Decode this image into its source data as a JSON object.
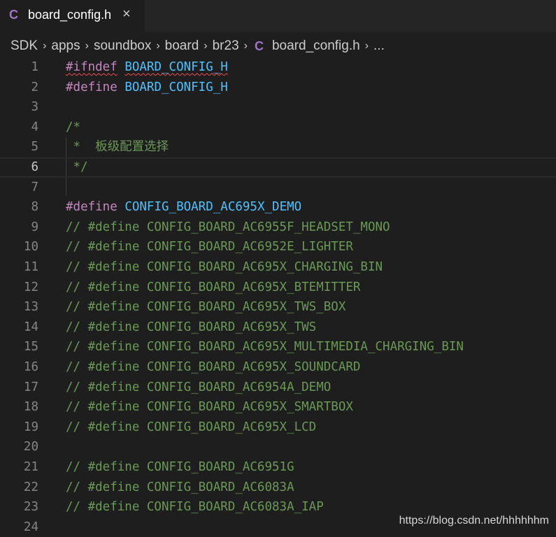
{
  "tab": {
    "icon": "C",
    "label": "board_config.h",
    "close": "×"
  },
  "breadcrumb": {
    "items": [
      "SDK",
      "apps",
      "soundbox",
      "board",
      "br23"
    ],
    "file_icon": "C",
    "file": "board_config.h",
    "more": "...",
    "separator": "›"
  },
  "editor": {
    "current_line": 6,
    "lines": [
      {
        "n": "1",
        "segs": [
          {
            "t": "#ifndef",
            "c": "kw"
          },
          {
            "t": " ",
            "c": ""
          },
          {
            "t": "BOARD_CONFIG_H",
            "c": "id"
          }
        ],
        "squiggle": true
      },
      {
        "n": "2",
        "segs": [
          {
            "t": "#define",
            "c": "kw"
          },
          {
            "t": " ",
            "c": ""
          },
          {
            "t": "BOARD_CONFIG_H",
            "c": "id"
          }
        ]
      },
      {
        "n": "3",
        "segs": []
      },
      {
        "n": "4",
        "segs": [
          {
            "t": "/*",
            "c": "cm"
          }
        ]
      },
      {
        "n": "5",
        "segs": [
          {
            "t": " *  板级配置选择",
            "c": "cm"
          }
        ]
      },
      {
        "n": "6",
        "segs": [
          {
            "t": " */",
            "c": "cm"
          }
        ]
      },
      {
        "n": "7",
        "segs": []
      },
      {
        "n": "8",
        "segs": [
          {
            "t": "#define",
            "c": "kw"
          },
          {
            "t": " ",
            "c": ""
          },
          {
            "t": "CONFIG_BOARD_AC695X_DEMO",
            "c": "id"
          }
        ]
      },
      {
        "n": "9",
        "segs": [
          {
            "t": "// #define CONFIG_BOARD_AC6955F_HEADSET_MONO",
            "c": "cm"
          }
        ]
      },
      {
        "n": "10",
        "segs": [
          {
            "t": "// #define CONFIG_BOARD_AC6952E_LIGHTER",
            "c": "cm"
          }
        ]
      },
      {
        "n": "11",
        "segs": [
          {
            "t": "// #define CONFIG_BOARD_AC695X_CHARGING_BIN",
            "c": "cm"
          }
        ]
      },
      {
        "n": "12",
        "segs": [
          {
            "t": "// #define CONFIG_BOARD_AC695X_BTEMITTER",
            "c": "cm"
          }
        ]
      },
      {
        "n": "13",
        "segs": [
          {
            "t": "// #define CONFIG_BOARD_AC695X_TWS_BOX",
            "c": "cm"
          }
        ]
      },
      {
        "n": "14",
        "segs": [
          {
            "t": "// #define CONFIG_BOARD_AC695X_TWS",
            "c": "cm"
          }
        ]
      },
      {
        "n": "15",
        "segs": [
          {
            "t": "// #define CONFIG_BOARD_AC695X_MULTIMEDIA_CHARGING_BIN",
            "c": "cm"
          }
        ]
      },
      {
        "n": "16",
        "segs": [
          {
            "t": "// #define CONFIG_BOARD_AC695X_SOUNDCARD",
            "c": "cm"
          }
        ]
      },
      {
        "n": "17",
        "segs": [
          {
            "t": "// #define CONFIG_BOARD_AC6954A_DEMO",
            "c": "cm"
          }
        ]
      },
      {
        "n": "18",
        "segs": [
          {
            "t": "// #define CONFIG_BOARD_AC695X_SMARTBOX",
            "c": "cm"
          }
        ]
      },
      {
        "n": "19",
        "segs": [
          {
            "t": "// #define CONFIG_BOARD_AC695X_LCD",
            "c": "cm"
          }
        ]
      },
      {
        "n": "20",
        "segs": []
      },
      {
        "n": "21",
        "segs": [
          {
            "t": "// #define CONFIG_BOARD_AC6951G",
            "c": "cm"
          }
        ]
      },
      {
        "n": "22",
        "segs": [
          {
            "t": "// #define CONFIG_BOARD_AC6083A",
            "c": "cm"
          }
        ]
      },
      {
        "n": "23",
        "segs": [
          {
            "t": "// #define CONFIG_BOARD_AC6083A_IAP",
            "c": "cm"
          }
        ]
      },
      {
        "n": "24",
        "segs": []
      }
    ]
  },
  "watermark": "https://blog.csdn.net/hhhhhhm",
  "colors": {
    "background": "#1e1e1e",
    "keyword": "#c586c0",
    "identifier": "#4fc1ff",
    "comment": "#6a9955",
    "line_number": "#858585",
    "c_icon": "#a074c4"
  }
}
